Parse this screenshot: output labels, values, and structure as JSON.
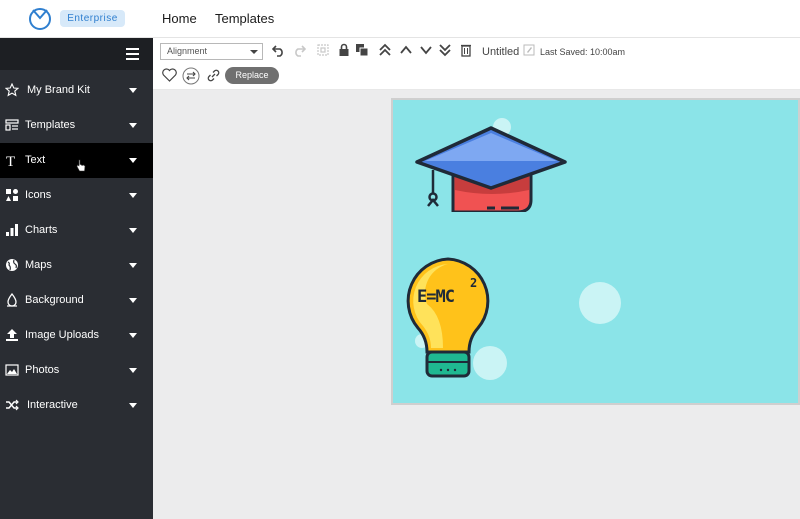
{
  "header": {
    "badge": "Enterprise",
    "nav": [
      "Home",
      "Templates"
    ]
  },
  "sidebar": {
    "items": [
      {
        "label": "My Brand Kit",
        "icon": "star-icon"
      },
      {
        "label": "Templates",
        "icon": "templates-icon"
      },
      {
        "label": "Text",
        "icon": "text-icon"
      },
      {
        "label": "Icons",
        "icon": "icons-grid-icon"
      },
      {
        "label": "Charts",
        "icon": "bar-chart-icon"
      },
      {
        "label": "Maps",
        "icon": "globe-icon"
      },
      {
        "label": "Background",
        "icon": "drop-icon"
      },
      {
        "label": "Image Uploads",
        "icon": "upload-icon"
      },
      {
        "label": "Photos",
        "icon": "photo-icon"
      },
      {
        "label": "Interactive",
        "icon": "shuffle-icon"
      }
    ],
    "active_item": "Text"
  },
  "toolbar": {
    "alignment_value": "Alignment",
    "doc_title": "Untitled",
    "last_saved": "Last Saved: 10:00am",
    "replace_label": "Replace"
  },
  "canvas": {
    "formula_text": "E=MC",
    "formula_exponent": "2"
  },
  "colors": {
    "sidebar_bg": "#2a2d33",
    "active_item_bg": "#000000",
    "canvas_bg": "#8be4e8",
    "badge_text": "#2f7fcf",
    "badge_bg": "#d7e9f9"
  }
}
